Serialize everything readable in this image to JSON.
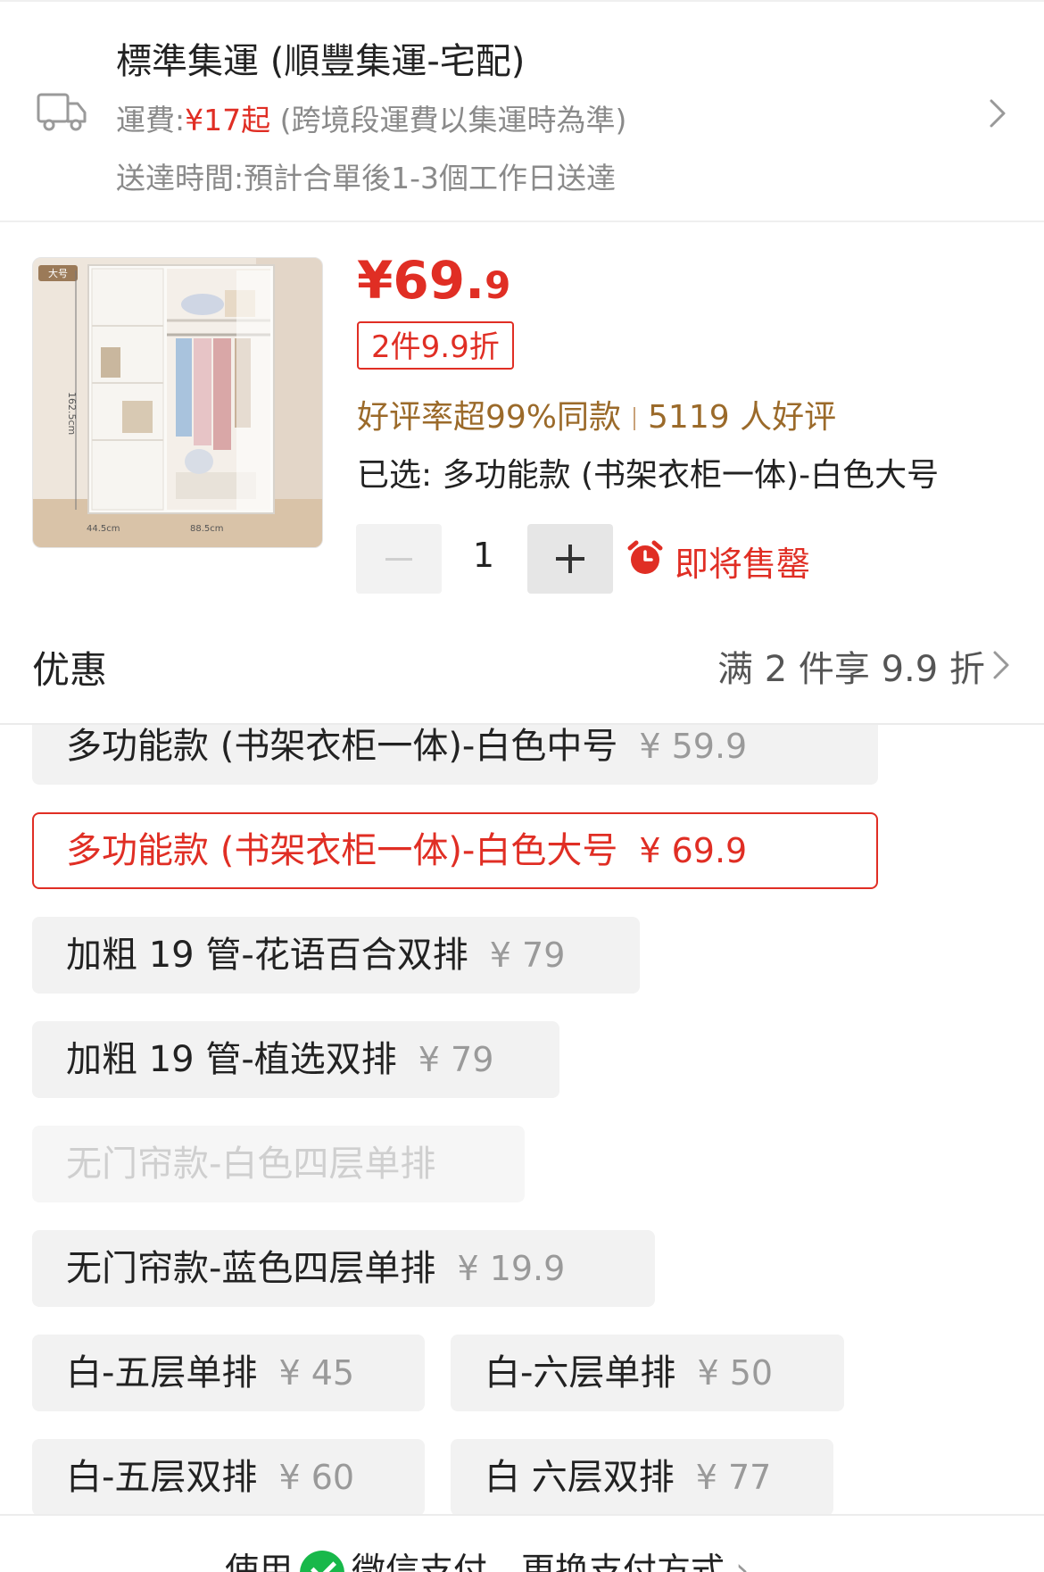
{
  "shipping": {
    "title": "標準集運 (順豐集運-宅配)",
    "fee_label": "運費:",
    "fee_value": "¥17起",
    "fee_note": " (跨境段運費以集運時為準)",
    "delivery": "送達時間:預計合單後1-3個工作日送達"
  },
  "product": {
    "thumb_badge": "大号",
    "thumb_height_label": "162.5cm",
    "thumb_depth_label": "44.5cm",
    "thumb_width_label": "88.5cm",
    "price_main": "¥69.",
    "price_decimal": "9",
    "discount_tag": "2件9.9折",
    "rating_text": "好评率超99%同款",
    "reviews_text": "5119 人好评",
    "selected_text": "已选: 多功能款 (书架衣柜一体)-白色大号",
    "quantity": "1",
    "stock_status": "即将售罄"
  },
  "promo": {
    "label": "优惠",
    "value": "满 2 件享 9.9 折"
  },
  "variants": [
    {
      "name": "多功能款 (书架衣柜一体)-白色中号",
      "price": "¥ 59.9",
      "state": "partial"
    },
    {
      "name": "多功能款 (书架衣柜一体)-白色大号",
      "price": "¥ 69.9",
      "state": "selected"
    },
    {
      "name": "加粗 19 管-花语百合双排",
      "price": "¥ 79",
      "state": "normal"
    },
    {
      "name": "加粗 19 管-植选双排",
      "price": "¥ 79",
      "state": "normal"
    },
    {
      "name": "无门帘款-白色四层单排",
      "price": "",
      "state": "disabled"
    },
    {
      "name": "无门帘款-蓝色四层单排",
      "price": "¥ 19.9",
      "state": "normal"
    },
    {
      "name": "白-五层单排",
      "price": "¥ 45",
      "state": "normal"
    },
    {
      "name": "白-六层单排",
      "price": "¥ 50",
      "state": "normal"
    },
    {
      "name": "白-五层双排",
      "price": "¥ 60",
      "state": "normal"
    },
    {
      "name": "白 六层双排",
      "price": "¥ 77",
      "state": "normal"
    }
  ],
  "footer": {
    "prefix": "使用",
    "method": "微信支付，更换支付方式",
    "chevron": "›"
  },
  "colors": {
    "accent_red": "#e02e24",
    "rating_brown": "#9b6a2a",
    "wechat_green": "#18b84a"
  }
}
